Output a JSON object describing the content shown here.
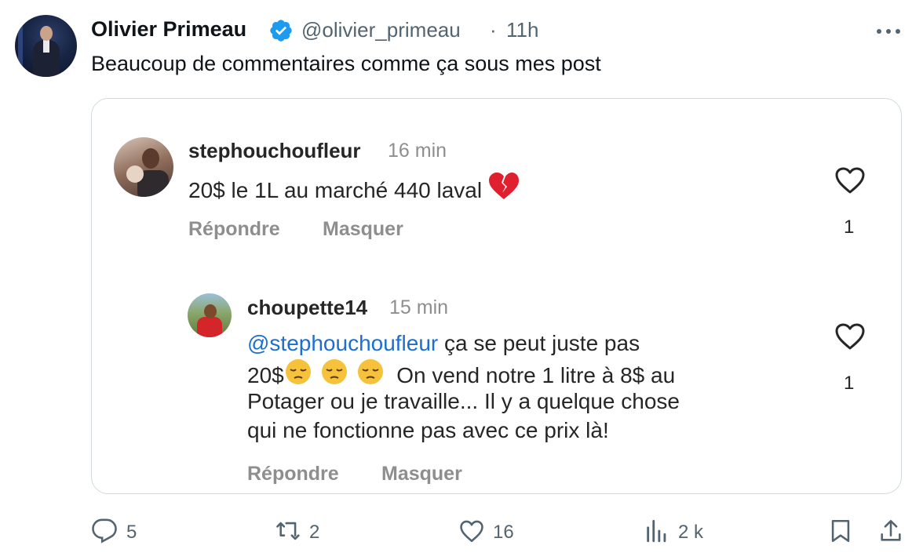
{
  "tweet": {
    "author_name": "Olivier Primeau",
    "handle": "@olivier_primeau",
    "separator": "·",
    "time": "11h",
    "text": "Beaucoup de commentaires comme ça sous mes post"
  },
  "embedded": {
    "comment1": {
      "username": "stephouchoufleur",
      "time": "16 min",
      "text": "20$ le 1L au marché 440 laval",
      "emoji": "broken-heart",
      "reply_label": "Répondre",
      "hide_label": "Masquer",
      "likes": "1"
    },
    "comment2": {
      "username": "choupette14",
      "time": "15 min",
      "mention": "@stephouchoufleur",
      "text_line1_rest": " ça se peut juste pas",
      "text_line2_prefix": "20$",
      "text_line2_rest": "  On vend notre 1 litre à 8$ au",
      "text_line3": "Potager ou je travaille... Il y a quelque chose",
      "text_line4": "qui ne fonctionne pas avec ce prix là!",
      "emoji": "pensive-face",
      "reply_label": "Répondre",
      "hide_label": "Masquer",
      "likes": "1"
    }
  },
  "actions": {
    "replies": "5",
    "retweets": "2",
    "likes": "16",
    "views": "2 k"
  },
  "colors": {
    "text_primary": "#0f1419",
    "text_secondary": "#536471",
    "verified": "#1d9bf0",
    "mention": "#1c6fd1",
    "card_border": "#cfd9de"
  }
}
